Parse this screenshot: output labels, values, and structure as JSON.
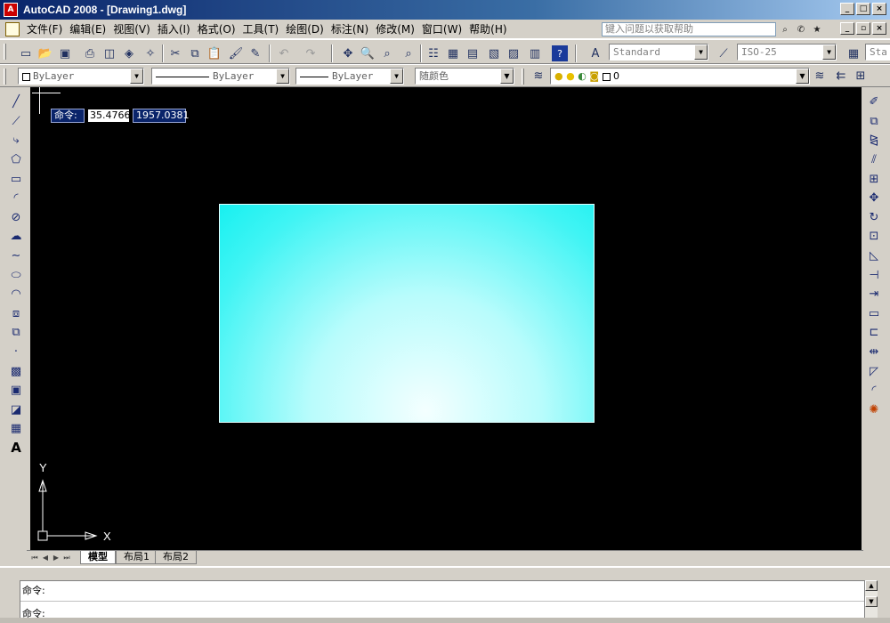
{
  "window": {
    "title": "AutoCAD 2008 - [Drawing1.dwg]",
    "app_icon_text": "A",
    "buttons": [
      "_",
      "□",
      "×"
    ]
  },
  "menu": {
    "items": [
      "文件(F)",
      "编辑(E)",
      "视图(V)",
      "插入(I)",
      "格式(O)",
      "工具(T)",
      "绘图(D)",
      "标注(N)",
      "修改(M)",
      "窗口(W)",
      "帮助(H)"
    ],
    "help_search_placeholder": "键入问题以获取帮助",
    "doc_buttons": [
      "_",
      "▫",
      "×"
    ]
  },
  "standard_toolbar": {
    "text_style": "Standard",
    "dim_style": "ISO-25",
    "table_style_partial": "Sta"
  },
  "properties_toolbar": {
    "layer_color": "ByLayer",
    "linetype": "ByLayer",
    "lineweight": "ByLayer",
    "plot_style": "随颜色",
    "current_layer": "0"
  },
  "canvas": {
    "background": "#000000",
    "command_prompt_label": "命令:",
    "coord_x": "35.4766",
    "coord_y": "1957.0381",
    "shape_fill_colors": [
      "#18f0f0",
      "#f4ffff"
    ],
    "ucs_x_label": "X",
    "ucs_y_label": "Y"
  },
  "tabs": {
    "items": [
      "模型",
      "布局1",
      "布局2"
    ],
    "active": 0
  },
  "command_window": {
    "line1": "命令:",
    "line2": "命令:"
  },
  "icons": {
    "left_toolbar": [
      "line-icon",
      "construction-line-icon",
      "polyline-icon",
      "polygon-icon",
      "rectangle-icon",
      "arc-icon",
      "circle-icon",
      "revision-cloud-icon",
      "spline-icon",
      "ellipse-icon",
      "ellipse-arc-icon",
      "insert-block-icon",
      "make-block-icon",
      "point-icon",
      "hatch-icon",
      "gradient-icon",
      "region-icon",
      "table-icon",
      "multiline-text-icon"
    ],
    "right_toolbar": [
      "erase-icon",
      "copy-icon",
      "mirror-icon",
      "offset-icon",
      "array-icon",
      "move-icon",
      "rotate-icon",
      "scale-icon",
      "stretch-icon",
      "trim-icon",
      "extend-icon",
      "break-at-point-icon",
      "break-icon",
      "join-icon",
      "chamfer-icon",
      "fillet-icon",
      "explode-icon"
    ]
  }
}
